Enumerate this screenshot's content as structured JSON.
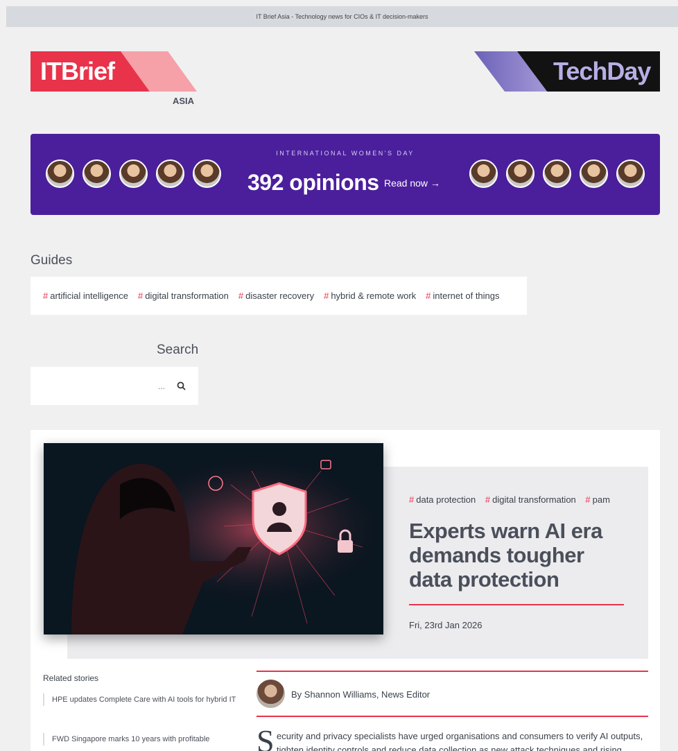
{
  "topbar": {
    "text": "IT Brief Asia - Technology news for CIOs & IT decision-makers"
  },
  "logos": {
    "itbrief": "ITBrief",
    "region": "ASIA",
    "techday": "TechDay"
  },
  "banner": {
    "kicker": "INTERNATIONAL WOMEN'S DAY",
    "headline": "392 opinions",
    "cta": "Read now →"
  },
  "guides": {
    "title": "Guides",
    "tags": [
      "artificial intelligence",
      "digital transformation",
      "disaster recovery",
      "hybrid & remote work",
      "internet of things"
    ]
  },
  "search": {
    "title": "Search",
    "placeholder": "..."
  },
  "hero": {
    "tags": [
      "data protection",
      "digital transformation",
      "pam"
    ],
    "headline": "Experts warn AI era demands tougher data protection",
    "date": "Fri, 23rd Jan 2026"
  },
  "related": {
    "title": "Related stories",
    "items": [
      "HPE updates Complete Care with AI tools for hybrid IT",
      "FWD Singapore marks 10 years with profitable"
    ]
  },
  "article": {
    "byline": "By Shannon Williams, News Editor",
    "dropcap": "S",
    "body": "ecurity and privacy specialists have urged organisations and consumers to verify AI outputs, tighten identity controls and reduce data collection as new attack techniques and rising"
  },
  "colors": {
    "accent": "#e8334a",
    "banner": "#4b1f9c"
  }
}
